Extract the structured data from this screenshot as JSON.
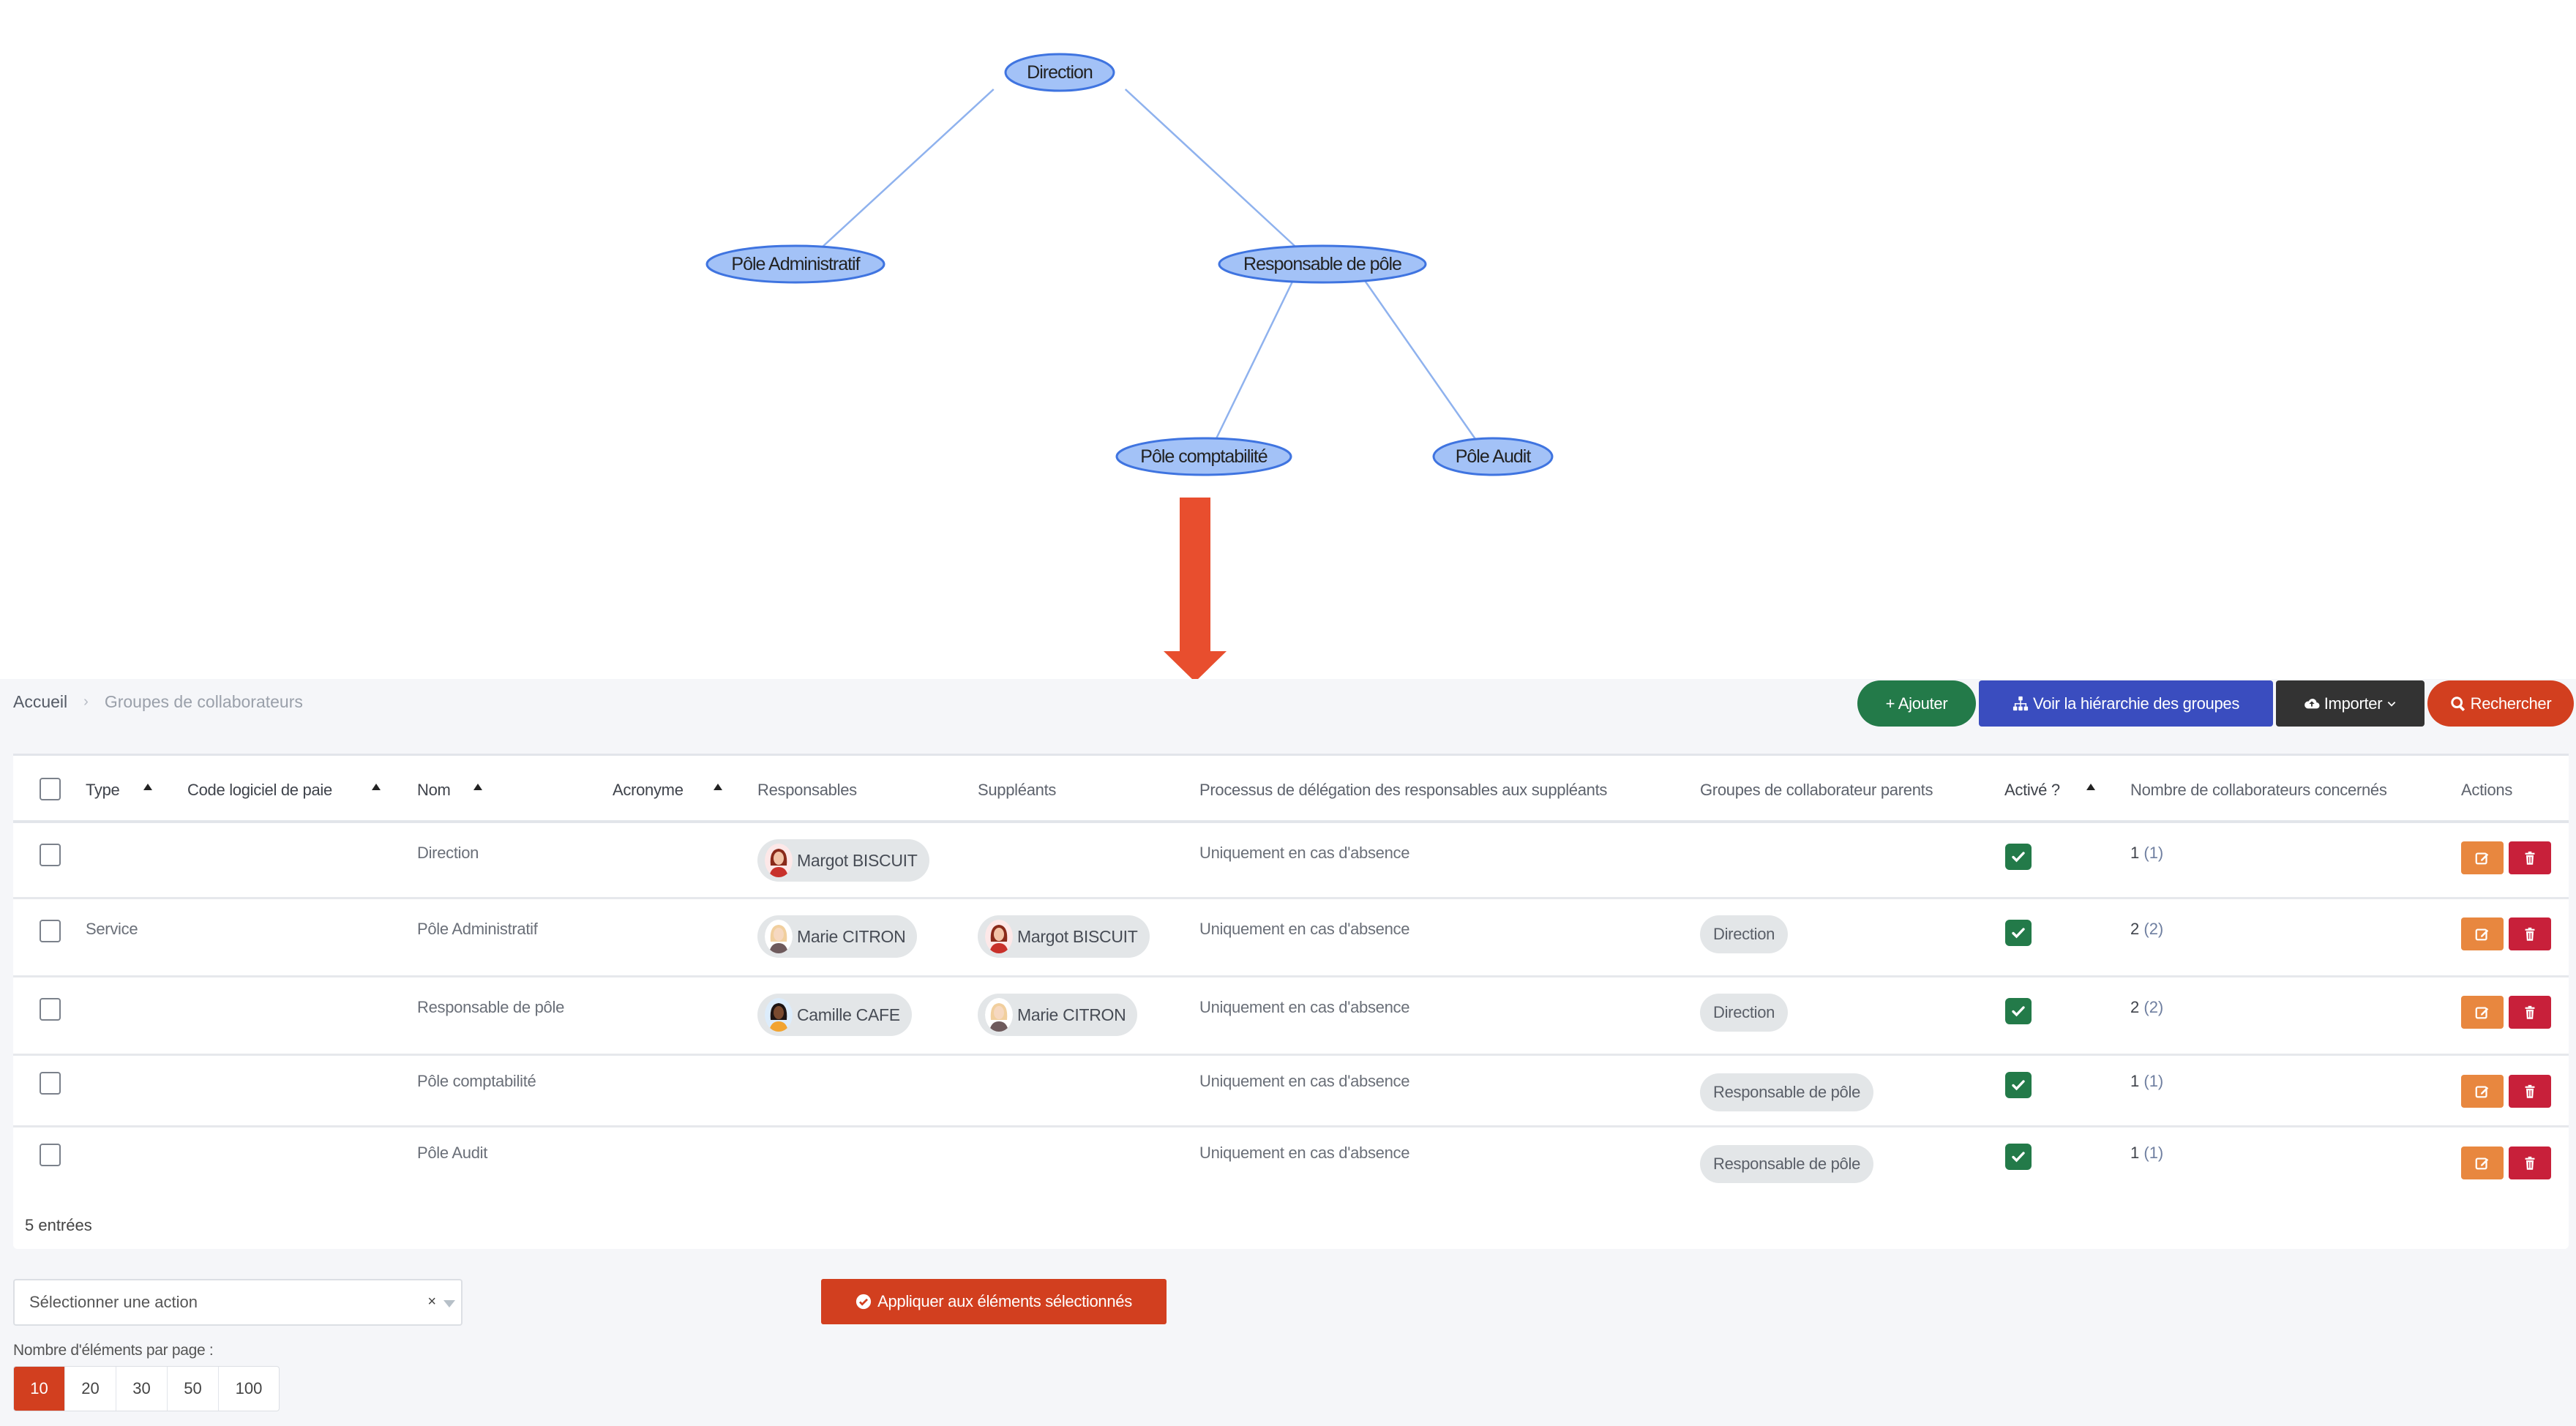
{
  "diagram": {
    "nodes": [
      {
        "id": "direction",
        "label": "Direction",
        "parent": null
      },
      {
        "id": "pole-administratif",
        "label": "Pôle Administratif",
        "parent": "direction"
      },
      {
        "id": "responsable-de-pole",
        "label": "Responsable de pôle",
        "parent": "direction"
      },
      {
        "id": "pole-comptabilite",
        "label": "Pôle comptabilité",
        "parent": "responsable-de-pole"
      },
      {
        "id": "pole-audit",
        "label": "Pôle Audit",
        "parent": "responsable-de-pole"
      }
    ],
    "colors": {
      "node_fill": "#a3c2f7",
      "node_stroke": "#3f74e0",
      "edge": "#8fb2ee",
      "arrow": "#e84e2e"
    }
  },
  "breadcrumb": {
    "home": "Accueil",
    "separator": "›",
    "current": "Groupes de collaborateurs"
  },
  "toolbar": {
    "add_label": "+ Ajouter",
    "hierarchy_label": "Voir la hiérarchie des groupes",
    "import_label": "Importer",
    "search_label": "Rechercher"
  },
  "table": {
    "headers": {
      "type": "Type",
      "payroll_code": "Code logiciel de paie",
      "name": "Nom",
      "acronym": "Acronyme",
      "managers": "Responsables",
      "deputies": "Suppléants",
      "delegation": "Processus de délégation des responsables aux suppléants",
      "parents": "Groupes de collaborateur parents",
      "active": "Activé ?",
      "count": "Nombre de collaborateurs concernés",
      "actions": "Actions"
    },
    "rows": [
      {
        "type": "",
        "payroll_code": "",
        "name": "Direction",
        "acronym": "",
        "managers": [
          "Margot BISCUIT"
        ],
        "deputies": [],
        "delegation": "Uniquement en cas d'absence",
        "parents": [],
        "active": true,
        "count": "1",
        "count_sub": "(1)"
      },
      {
        "type": "Service",
        "payroll_code": "",
        "name": "Pôle Administratif",
        "acronym": "",
        "managers": [
          "Marie CITRON"
        ],
        "deputies": [
          "Margot BISCUIT"
        ],
        "delegation": "Uniquement en cas d'absence",
        "parents": [
          "Direction"
        ],
        "active": true,
        "count": "2",
        "count_sub": "(2)"
      },
      {
        "type": "",
        "payroll_code": "",
        "name": "Responsable de pôle",
        "acronym": "",
        "managers": [
          "Camille CAFE"
        ],
        "deputies": [
          "Marie CITRON"
        ],
        "delegation": "Uniquement en cas d'absence",
        "parents": [
          "Direction"
        ],
        "active": true,
        "count": "2",
        "count_sub": "(2)"
      },
      {
        "type": "",
        "payroll_code": "",
        "name": "Pôle comptabilité",
        "acronym": "",
        "managers": [],
        "deputies": [],
        "delegation": "Uniquement en cas d'absence",
        "parents": [
          "Responsable de pôle"
        ],
        "active": true,
        "count": "1",
        "count_sub": "(1)"
      },
      {
        "type": "",
        "payroll_code": "",
        "name": "Pôle Audit",
        "acronym": "",
        "managers": [],
        "deputies": [],
        "delegation": "Uniquement en cas d'absence",
        "parents": [
          "Responsable de pôle"
        ],
        "active": true,
        "count": "1",
        "count_sub": "(1)"
      }
    ],
    "entries_label": "5 entrées"
  },
  "bulk": {
    "select_placeholder": "Sélectionner une action",
    "clear_glyph": "×",
    "apply_label": "Appliquer aux éléments sélectionnés"
  },
  "pagination": {
    "label": "Nombre d'éléments par page :",
    "options": [
      "10",
      "20",
      "30",
      "50",
      "100"
    ],
    "selected": "10"
  }
}
